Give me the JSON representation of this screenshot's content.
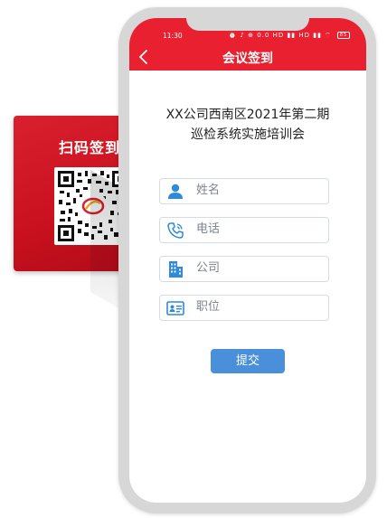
{
  "poster": {
    "title": "扫码签到"
  },
  "status_bar": {
    "time": "11:30",
    "icons_text": "⏰ ♪ ⊕ 0.0 HD ▮▮ HD ▮▮ ⌔",
    "battery": "85"
  },
  "nav": {
    "title": "会议签到",
    "back_icon": "chevron-left-icon"
  },
  "form": {
    "title_line1": "XX公司西南区2021年第二期",
    "title_line2": "巡检系统实施培训会",
    "fields": [
      {
        "icon": "user-icon",
        "placeholder": "姓名"
      },
      {
        "icon": "phone-icon",
        "placeholder": "电话"
      },
      {
        "icon": "building-icon",
        "placeholder": "公司"
      },
      {
        "icon": "id-card-icon",
        "placeholder": "职位"
      }
    ],
    "submit_label": "提交"
  },
  "colors": {
    "brand_red": "#e8202f",
    "button_blue": "#4a8fd9",
    "icon_blue": "#2f8ad8"
  }
}
